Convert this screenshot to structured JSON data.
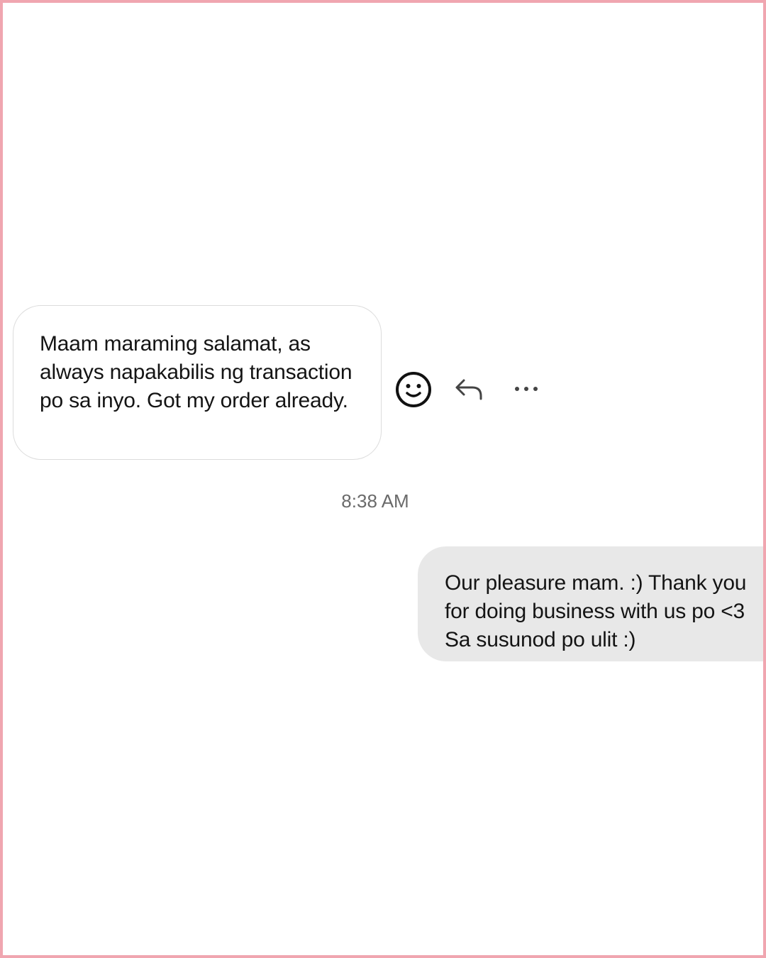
{
  "conversation": {
    "incoming_message": {
      "text": "Maam maraming salamat, as always napakabilis ng transaction po sa inyo. Got my order already."
    },
    "message_actions": [
      {
        "icon": "smiley-icon",
        "label": "React"
      },
      {
        "icon": "reply-icon",
        "label": "Reply"
      },
      {
        "icon": "more-options-icon",
        "label": "More"
      }
    ],
    "timestamp": "8:38 AM",
    "outgoing_message": {
      "text": "Our pleasure mam. :) Thank you for doing business with us po <3 Sa susunod po ulit :)"
    }
  },
  "colors": {
    "frame_border": "#f0a6b0",
    "outgoing_bubble": "#e8e8e8",
    "incoming_bubble_border": "#dcdcdc",
    "timestamp_text": "#6a6a6a"
  }
}
